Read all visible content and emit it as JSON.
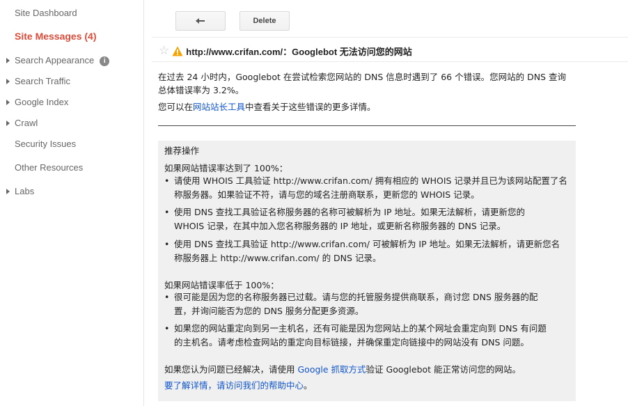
{
  "sidebar": {
    "items": [
      {
        "label": "Site Dashboard",
        "expandable": false,
        "active": false
      },
      {
        "label": "Site Messages (4)",
        "expandable": false,
        "active": true
      },
      {
        "label": "Search Appearance",
        "expandable": true,
        "active": false,
        "info": "i"
      },
      {
        "label": "Search Traffic",
        "expandable": true,
        "active": false
      },
      {
        "label": "Google Index",
        "expandable": true,
        "active": false
      },
      {
        "label": "Crawl",
        "expandable": true,
        "active": false
      },
      {
        "label": "Security Issues",
        "expandable": false,
        "active": false
      },
      {
        "label": "Other Resources",
        "expandable": false,
        "active": false
      },
      {
        "label": "Labs",
        "expandable": true,
        "active": false
      }
    ]
  },
  "toolbar": {
    "back_icon": "back-arrow-icon",
    "delete_label": "Delete"
  },
  "message": {
    "subject": "http://www.crifan.com/：Googlebot 无法访问您的网站",
    "intro_line1": "在过去 24 小时内，Googlebot 在尝试检索您网站的 DNS 信息时遇到了 66 个错误。您网站的 DNS 查询",
    "intro_line2": "总体错误率为 3.2%。",
    "tool_prefix": "您可以在",
    "tool_link": "网站站长工具",
    "tool_suffix": "中查看关于这些错误的更多详情。"
  },
  "recommendations": {
    "title": "推荐操作",
    "case100_heading": "如果网站错误率达到了 100%：",
    "case100_items": [
      {
        "l1": "请使用 WHOIS 工具验证 http://www.crifan.com/ 拥有相应的 WHOIS 记录并且已为该网站配置了名",
        "l2": "称服务器。如果验证不符，请与您的域名注册商联系，更新您的 WHOIS 记录。"
      },
      {
        "l1": "使用 DNS 查找工具验证名称服务器的名称可被解析为 IP 地址。如果无法解析，请更新您的",
        "l2": "WHOIS 记录，在其中加入您名称服务器的 IP 地址，或更新名称服务器的 DNS 记录。"
      },
      {
        "l1": "使用 DNS 查找工具验证 http://www.crifan.com/ 可被解析为 IP 地址。如果无法解析，请更新您名",
        "l2": "称服务器上 http://www.crifan.com/ 的 DNS 记录。"
      }
    ],
    "caseLess_heading": "如果网站错误率低于 100%：",
    "caseLess_items": [
      {
        "l1": "很可能是因为您的名称服务器已过载。请与您的托管服务提供商联系，商讨您 DNS 服务器的配",
        "l2": "置，并询问能否为您的 DNS 服务分配更多资源。"
      },
      {
        "l1": "如果您的网站重定向到另一主机名，还有可能是因为您网站上的某个网址会重定向到 DNS 有问题",
        "l2": "的主机名。请考虑检查网站的重定向目标链接，并确保重定向链接中的网站没有 DNS 问题。"
      }
    ],
    "resolved_prefix": "如果您认为问题已经解决，请使用 ",
    "resolved_link": "Google 抓取方式",
    "resolved_suffix": "验证 Googlebot 能正常访问您的网站。",
    "help_link": "要了解详情，请访问我们的帮助中心",
    "help_suffix": "。"
  },
  "colors": {
    "active_nav": "#dd4b39",
    "link": "#1155cc",
    "warning": "#f4a300"
  }
}
